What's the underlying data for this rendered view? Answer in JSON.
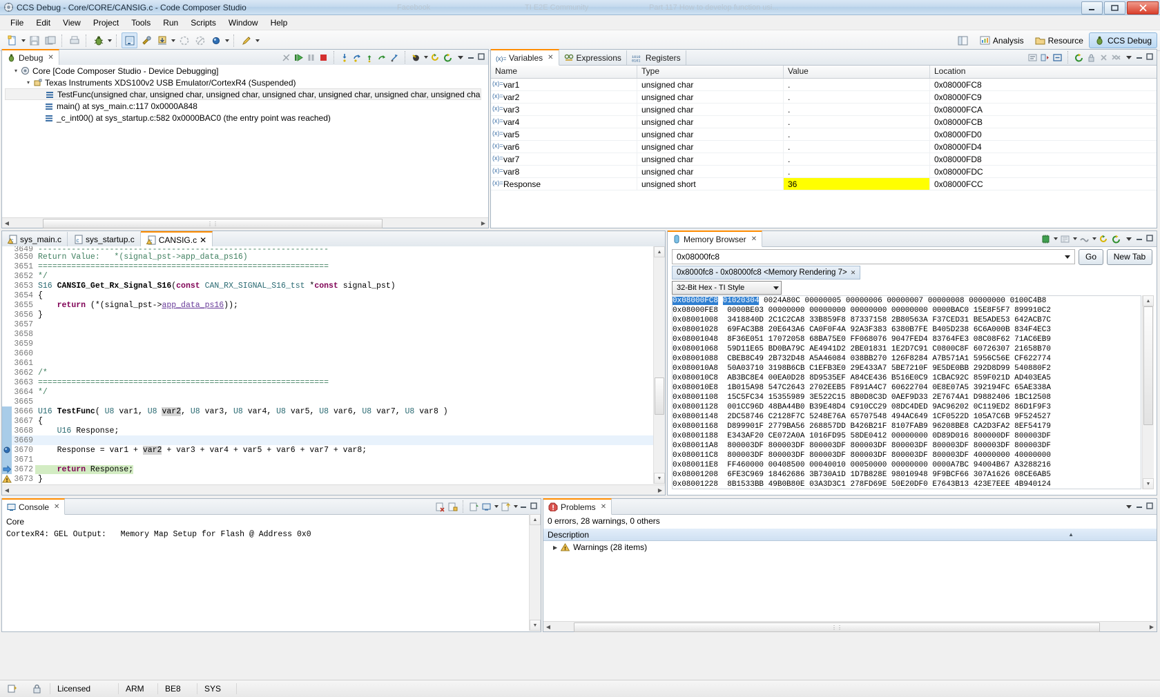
{
  "window": {
    "title": "CCS Debug - Core/CORE/CANSIG.c - Code Composer Studio",
    "ghost_tabs": [
      "Facebook",
      "TI E2E Community",
      "Part 117 How to develop function usi..."
    ],
    "min": "—",
    "max": "▢",
    "close": "✕"
  },
  "menu": [
    "File",
    "Edit",
    "View",
    "Project",
    "Tools",
    "Run",
    "Scripts",
    "Window",
    "Help"
  ],
  "perspective": {
    "analysis": "Analysis",
    "resource": "Resource",
    "ccs_debug": "CCS Debug"
  },
  "debug_view": {
    "tab": "Debug",
    "nodes": [
      {
        "indent": 0,
        "label": "Core [Code Composer Studio - Device Debugging]",
        "icon": "core-icon",
        "expander": "▴"
      },
      {
        "indent": 1,
        "label": "Texas Instruments XDS100v2 USB Emulator/CortexR4 (Suspended)",
        "icon": "emulator-icon",
        "expander": "▴"
      },
      {
        "indent": 2,
        "label": "TestFunc(unsigned char, unsigned char, unsigned char, unsigned char, unsigned char, unsigned char, unsigned char, unsigned",
        "icon": "stack-frame-icon",
        "expander": ""
      },
      {
        "indent": 2,
        "label": "main() at sys_main.c:117 0x0000A848",
        "icon": "stack-frame-icon",
        "expander": ""
      },
      {
        "indent": 2,
        "label": "_c_int00() at sys_startup.c:582 0x0000BAC0  (the entry point was reached)",
        "icon": "stack-frame-icon",
        "expander": ""
      }
    ]
  },
  "variables_view": {
    "tabs": [
      {
        "label": "Variables",
        "icon": "variables-icon",
        "active": true,
        "closable": true
      },
      {
        "label": "Expressions",
        "icon": "expressions-icon",
        "active": false,
        "closable": false
      },
      {
        "label": "Registers",
        "icon": "registers-icon",
        "active": false,
        "closable": false
      }
    ],
    "columns": [
      "Name",
      "Type",
      "Value",
      "Location"
    ],
    "rows": [
      {
        "name": "var1",
        "type": "unsigned char",
        "value": ".",
        "location": "0x08000FC8",
        "highlight": false
      },
      {
        "name": "var2",
        "type": "unsigned char",
        "value": ".",
        "location": "0x08000FC9",
        "highlight": false
      },
      {
        "name": "var3",
        "type": "unsigned char",
        "value": ".",
        "location": "0x08000FCA",
        "highlight": false
      },
      {
        "name": "var4",
        "type": "unsigned char",
        "value": ".",
        "location": "0x08000FCB",
        "highlight": false
      },
      {
        "name": "var5",
        "type": "unsigned char",
        "value": ".",
        "location": "0x08000FD0",
        "highlight": false
      },
      {
        "name": "var6",
        "type": "unsigned char",
        "value": ".",
        "location": "0x08000FD4",
        "highlight": false
      },
      {
        "name": "var7",
        "type": "unsigned char",
        "value": ".",
        "location": "0x08000FD8",
        "highlight": false
      },
      {
        "name": "var8",
        "type": "unsigned char",
        "value": ".",
        "location": "0x08000FDC",
        "highlight": false
      },
      {
        "name": "Response",
        "type": "unsigned short",
        "value": "36",
        "location": "0x08000FCC",
        "highlight": true
      }
    ]
  },
  "editor": {
    "tabs": [
      {
        "label": "sys_main.c",
        "active": false,
        "warn": true
      },
      {
        "label": "sys_startup.c",
        "active": false,
        "warn": false
      },
      {
        "label": "CANSIG.c",
        "active": true,
        "warn": true
      }
    ],
    "lines": [
      {
        "n": "3649",
        "text": "-------------------------------------------------------------",
        "style": "comment",
        "clip": true
      },
      {
        "n": "3650",
        "text": "Return Value:   *(signal_pst->app_data_ps16)",
        "style": "comment"
      },
      {
        "n": "3651",
        "text": "=============================================================",
        "style": "comment"
      },
      {
        "n": "3652",
        "text": "*/",
        "style": "comment"
      },
      {
        "n": "3653",
        "text": "S16 CANSIG_Get_Rx_Signal_S16(const CAN_RX_SIGNAL_S16_tst *const signal_pst)",
        "style": "decl"
      },
      {
        "n": "3654",
        "text": "{",
        "style": "plain"
      },
      {
        "n": "3655",
        "text": "    return (*(signal_pst->app_data_ps16));",
        "style": "return_stmt"
      },
      {
        "n": "3656",
        "text": "}",
        "style": "plain"
      },
      {
        "n": "3657",
        "text": "",
        "style": "plain"
      },
      {
        "n": "3658",
        "text": "",
        "style": "plain"
      },
      {
        "n": "3659",
        "text": "",
        "style": "plain"
      },
      {
        "n": "3660",
        "text": "",
        "style": "plain"
      },
      {
        "n": "3661",
        "text": "",
        "style": "plain"
      },
      {
        "n": "3662",
        "text": "/*",
        "style": "comment"
      },
      {
        "n": "3663",
        "text": "=============================================================",
        "style": "comment"
      },
      {
        "n": "3664",
        "text": "*/",
        "style": "comment"
      },
      {
        "n": "3665",
        "text": "",
        "style": "plain"
      },
      {
        "n": "3666",
        "text": "U16 TestFunc( U8 var1, U8 var2, U8 var3, U8 var4, U8 var5, U8 var6, U8 var7, U8 var8 )",
        "style": "funcdecl"
      },
      {
        "n": "3667",
        "text": "{",
        "style": "plain"
      },
      {
        "n": "3668",
        "text": "    U16 Response;",
        "style": "vardecl"
      },
      {
        "n": "3669",
        "text": "",
        "style": "current"
      },
      {
        "n": "3670",
        "text": "    Response = var1 + var2 + var3 + var4 + var5 + var6 + var7 + var8;",
        "style": "assign"
      },
      {
        "n": "3671",
        "text": "",
        "style": "plain"
      },
      {
        "n": "3672",
        "text": "    return Response;",
        "style": "green_return"
      },
      {
        "n": "3673",
        "text": "}",
        "style": "plain"
      }
    ]
  },
  "memory_view": {
    "tab": "Memory Browser",
    "address_value": "0x08000fc8",
    "go_button": "Go",
    "new_tab_button": "New Tab",
    "rendering_tab": "0x8000fc8 - 0x08000fc8 <Memory Rendering 7>",
    "format": "32-Bit Hex - TI Style",
    "rows": [
      {
        "addr": "0x08000FC8",
        "words": [
          "01020304",
          "0024A80C",
          "00000005",
          "00000006",
          "00000007",
          "00000008",
          "00000000",
          "0100C4B8"
        ],
        "sel_addr": true,
        "sel_first": true
      },
      {
        "addr": "0x08000FE8",
        "words": [
          "0000BE03",
          "00000000",
          "00000000",
          "00000000",
          "00000000",
          "0000BAC0",
          "15E8F5F7",
          "899910C2"
        ]
      },
      {
        "addr": "0x08001008",
        "words": [
          "3418840D",
          "2C1C2CA8",
          "33B859F8",
          "87337158",
          "2B80563A",
          "F37CED31",
          "BE5ADE53",
          "642ACB7C"
        ]
      },
      {
        "addr": "0x08001028",
        "words": [
          "69FAC3B8",
          "20E643A6",
          "CA0F0F4A",
          "92A3F383",
          "6380B7FE",
          "B405D238",
          "6C6A000B",
          "834F4EC3"
        ]
      },
      {
        "addr": "0x08001048",
        "words": [
          "8F36E051",
          "17072058",
          "68BA75E0",
          "FF068076",
          "9047FED4",
          "83764FE3",
          "08C08F62",
          "71AC6EB9"
        ]
      },
      {
        "addr": "0x08001068",
        "words": [
          "59D11E65",
          "BD0BA79C",
          "AE4941D2",
          "2BE01831",
          "1E2D7C91",
          "C0800C8F",
          "60726307",
          "21658B70"
        ]
      },
      {
        "addr": "0x08001088",
        "words": [
          "CBEB8C49",
          "2B732D48",
          "A5A46084",
          "038BB270",
          "126F8284",
          "A7B571A1",
          "5956C56E",
          "CF622774"
        ]
      },
      {
        "addr": "0x080010A8",
        "words": [
          "50A03710",
          "3198B6CB",
          "C1EFB3E0",
          "29E433A7",
          "5BE7210F",
          "9E5DE0BB",
          "292D8D99",
          "540880F2"
        ]
      },
      {
        "addr": "0x080010C8",
        "words": [
          "AB3BC8E4",
          "00EA0D28",
          "8D9535EF",
          "A84CE436",
          "B516E0C9",
          "1CBAC92C",
          "859F021D",
          "AD403EA5"
        ]
      },
      {
        "addr": "0x080010E8",
        "words": [
          "1B015A98",
          "547C2643",
          "2702EEB5",
          "F891A4C7",
          "60622704",
          "0E8E07A5",
          "392194FC",
          "65AE338A"
        ]
      },
      {
        "addr": "0x08001108",
        "words": [
          "15C5FC34",
          "15355989",
          "3E522C15",
          "8B0D8C3D",
          "0AEF9D33",
          "2E7674A1",
          "D9882406",
          "1BC12508"
        ]
      },
      {
        "addr": "0x08001128",
        "words": [
          "001CC96D",
          "48BA44B0",
          "B39E48D4",
          "C910CC29",
          "08DC4DED",
          "9AC96202",
          "0C119ED2",
          "86D1F9F3"
        ]
      },
      {
        "addr": "0x08001148",
        "words": [
          "2DC58746",
          "C2128F7C",
          "5248E76A",
          "65707548",
          "494AC649",
          "1CF0522D",
          "105A7C6B",
          "9F524527"
        ]
      },
      {
        "addr": "0x08001168",
        "words": [
          "D899901F",
          "2779BA56",
          "268857DD",
          "B426B21F",
          "8107FAB9",
          "96208BE8",
          "CA2D3FA2",
          "8EF54179"
        ]
      },
      {
        "addr": "0x08001188",
        "words": [
          "E343AF20",
          "CE072A0A",
          "1016FD95",
          "58DE0412",
          "00000000",
          "0D89D016",
          "800000DF",
          "800003DF"
        ]
      },
      {
        "addr": "0x080011A8",
        "words": [
          "800003DF",
          "800003DF",
          "800003DF",
          "800003DF",
          "800003DF",
          "800003DF",
          "800003DF",
          "800003DF"
        ]
      },
      {
        "addr": "0x080011C8",
        "words": [
          "800003DF",
          "800003DF",
          "800003DF",
          "800003DF",
          "800003DF",
          "800003DF",
          "40000000",
          "40000000"
        ]
      },
      {
        "addr": "0x080011E8",
        "words": [
          "FF460000",
          "00408500",
          "00040010",
          "00050000",
          "00000000",
          "0000A7BC",
          "94004B67",
          "A3288216"
        ]
      },
      {
        "addr": "0x08001208",
        "words": [
          "6FE3C969",
          "18462686",
          "3B730A1D",
          "1D7B828E",
          "98010948",
          "9F9BCF66",
          "307A1626",
          "08CE6AB5"
        ]
      },
      {
        "addr": "0x08001228",
        "words": [
          "8B1533BB",
          "49B0B80E",
          "03A3D3C1",
          "278FD69E",
          "50E20DF0",
          "E7643B13",
          "423E7EEE",
          "4B940124"
        ]
      }
    ]
  },
  "console_view": {
    "tab": "Console",
    "context": "Core",
    "output": "CortexR4: GEL Output:   Memory Map Setup for Flash @ Address 0x0"
  },
  "problems_view": {
    "tab": "Problems",
    "summary": "0 errors, 28 warnings, 0 others",
    "column": "Description",
    "rows": [
      {
        "label": "Warnings (28 items)",
        "icon": "warning-icon",
        "expander": "▸"
      }
    ]
  },
  "status_bar": {
    "license": "Licensed",
    "arm": "ARM",
    "be8": "BE8",
    "sys": "SYS"
  },
  "colors": {
    "accent_orange": "#ff8c00",
    "selection_blue": "#2f7fd1",
    "highlight_yellow": "#ffff00",
    "green_exec_line": "#d3ecc3"
  }
}
